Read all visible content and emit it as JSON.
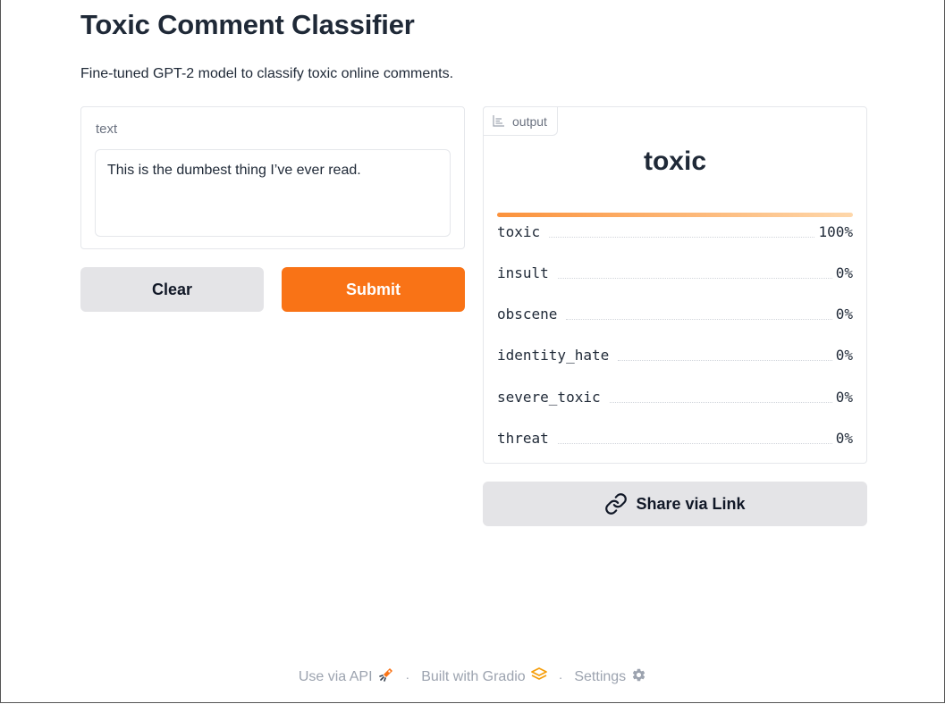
{
  "page": {
    "title": "Toxic Comment Classifier",
    "description": "Fine-tuned GPT-2 model to classify toxic online comments."
  },
  "input": {
    "label": "text",
    "value": "This is the dumbest thing I’ve ever read."
  },
  "buttons": {
    "clear": "Clear",
    "submit": "Submit",
    "share": "Share via Link"
  },
  "output": {
    "tag_label": "output",
    "tag_icon": "bar-chart-icon",
    "predicted_label": "toxic",
    "confidences": [
      {
        "label": "toxic",
        "value": "100%"
      },
      {
        "label": "insult",
        "value": "0%"
      },
      {
        "label": "obscene",
        "value": "0%"
      },
      {
        "label": "identity_hate",
        "value": "0%"
      },
      {
        "label": "severe_toxic",
        "value": "0%"
      },
      {
        "label": "threat",
        "value": "0%"
      }
    ]
  },
  "footer": {
    "api": "Use via API",
    "api_icon": "rocket-icon",
    "separator": "·",
    "built": "Built with Gradio",
    "built_icon": "gradio-logo-icon",
    "settings": "Settings",
    "settings_icon": "gear-icon"
  },
  "colors": {
    "accent": "#f97316",
    "secondary_button": "#e4e4e7",
    "confidence_bar_start": "#fb923c",
    "confidence_bar_end": "#fed7aa"
  }
}
